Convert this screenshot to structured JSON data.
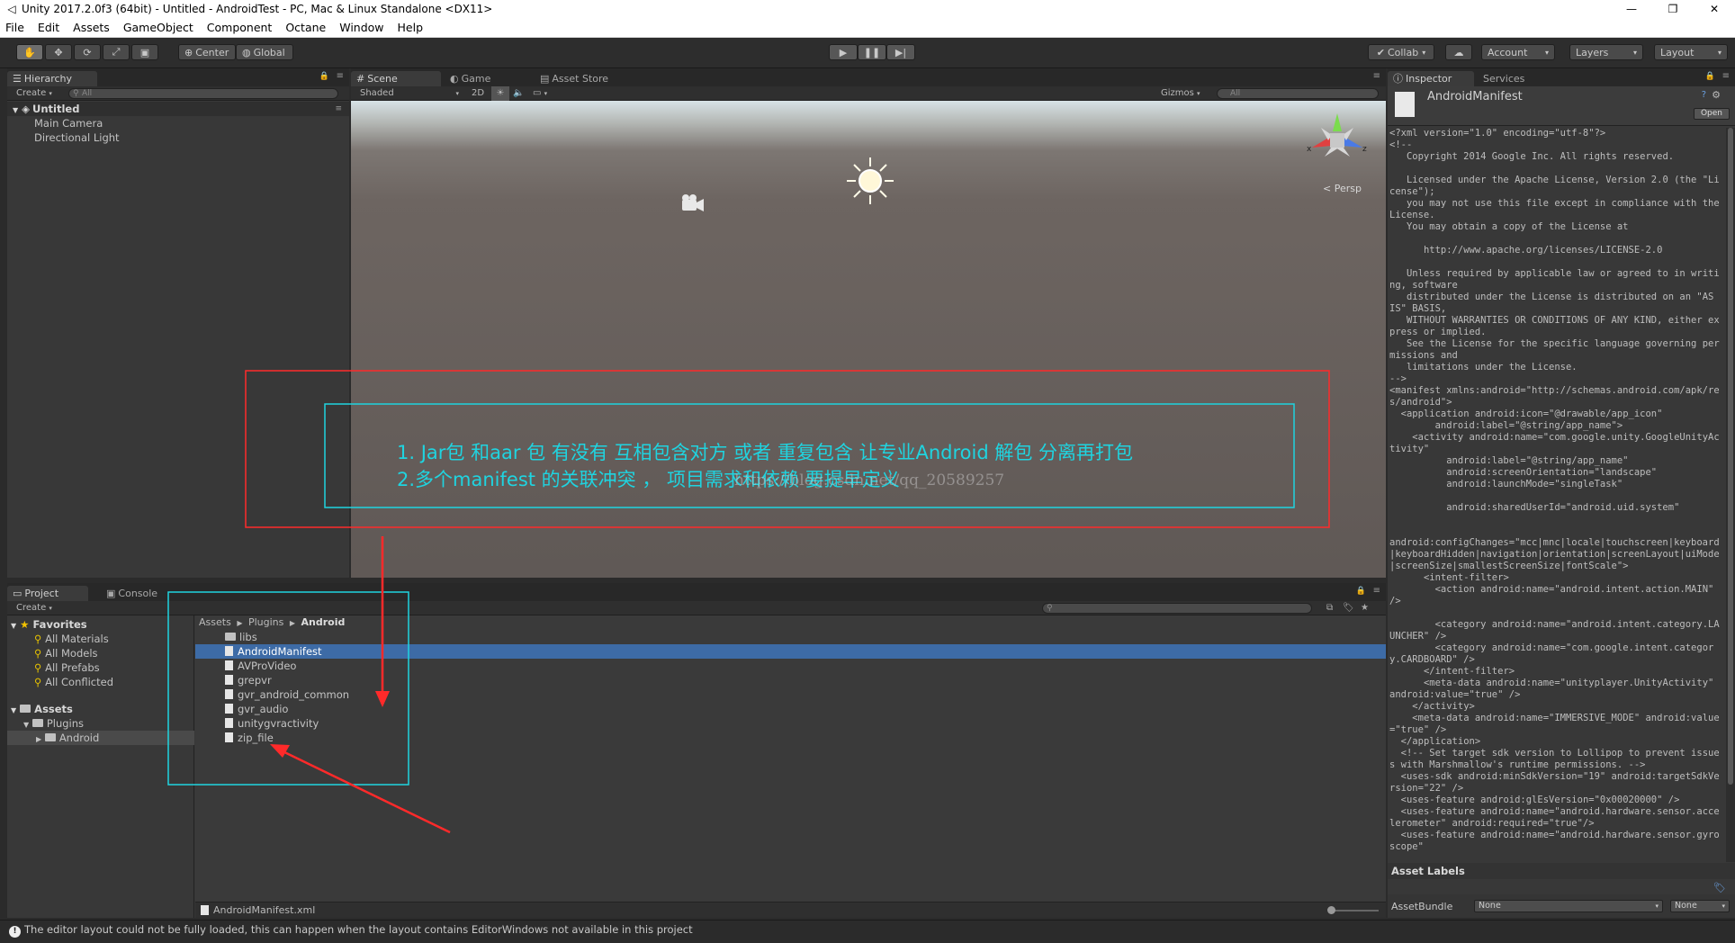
{
  "window": {
    "title": "Unity 2017.2.0f3 (64bit) - Untitled - AndroidTest - PC, Mac & Linux Standalone <DX11>",
    "minimize": "—",
    "maximize": "❐",
    "close": "✕"
  },
  "menu": [
    "File",
    "Edit",
    "Assets",
    "GameObject",
    "Component",
    "Octane",
    "Window",
    "Help"
  ],
  "toolbar": {
    "pivot": "Center",
    "space": "Global",
    "collab": "Collab",
    "account": "Account",
    "layers": "Layers",
    "layout": "Layout"
  },
  "hierarchy": {
    "tab": "Hierarchy",
    "create": "Create",
    "search_placeholder": "All",
    "scene": "Untitled",
    "items": [
      "Main Camera",
      "Directional Light"
    ]
  },
  "scene_view": {
    "tabs": [
      "Scene",
      "Game",
      "Asset Store"
    ],
    "shading": "Shaded",
    "mode_2d": "2D",
    "gizmos": "Gizmos",
    "search_placeholder": "All",
    "persp": "Persp",
    "axis_x": "x",
    "axis_z": "z"
  },
  "project": {
    "tabs": [
      "Project",
      "Console"
    ],
    "create": "Create",
    "favorites_label": "Favorites",
    "favorites": [
      "All Materials",
      "All Models",
      "All Prefabs",
      "All Conflicted"
    ],
    "assets_label": "Assets",
    "plugins_label": "Plugins",
    "android_label": "Android",
    "breadcrumb": [
      "Assets",
      "Plugins",
      "Android"
    ],
    "files": [
      {
        "name": "libs",
        "kind": "folder"
      },
      {
        "name": "AndroidManifest",
        "kind": "file",
        "selected": true
      },
      {
        "name": "AVProVideo",
        "kind": "file"
      },
      {
        "name": "grepvr",
        "kind": "file"
      },
      {
        "name": "gvr_android_common",
        "kind": "file"
      },
      {
        "name": "gvr_audio",
        "kind": "file"
      },
      {
        "name": "unitygvractivity",
        "kind": "file"
      },
      {
        "name": "zip_file",
        "kind": "file"
      }
    ],
    "footer_file": "AndroidManifest.xml"
  },
  "inspector": {
    "tabs": [
      "Inspector",
      "Services"
    ],
    "asset_name": "AndroidManifest",
    "open_button": "Open",
    "code": "<?xml version=\"1.0\" encoding=\"utf-8\"?>\n<!--\n   Copyright 2014 Google Inc. All rights reserved.\n\n   Licensed under the Apache License, Version 2.0 (the \"License\");\n   you may not use this file except in compliance with the License.\n   You may obtain a copy of the License at\n\n      http://www.apache.org/licenses/LICENSE-2.0\n\n   Unless required by applicable law or agreed to in writing, software\n   distributed under the License is distributed on an \"AS IS\" BASIS,\n   WITHOUT WARRANTIES OR CONDITIONS OF ANY KIND, either express or implied.\n   See the License for the specific language governing permissions and\n   limitations under the License.\n-->\n<manifest xmlns:android=\"http://schemas.android.com/apk/res/android\">\n  <application android:icon=\"@drawable/app_icon\"\n        android:label=\"@string/app_name\">\n    <activity android:name=\"com.google.unity.GoogleUnityActivity\"\n          android:label=\"@string/app_name\"\n          android:screenOrientation=\"landscape\"\n          android:launchMode=\"singleTask\"\n\n          android:sharedUserId=\"android.uid.system\"\n\n\nandroid:configChanges=\"mcc|mnc|locale|touchscreen|keyboard|keyboardHidden|navigation|orientation|screenLayout|uiMode|screenSize|smallestScreenSize|fontScale\">\n      <intent-filter>\n        <action android:name=\"android.intent.action.MAIN\" />\n\n        <category android:name=\"android.intent.category.LAUNCHER\" />\n        <category android:name=\"com.google.intent.category.CARDBOARD\" />\n      </intent-filter>\n      <meta-data android:name=\"unityplayer.UnityActivity\" android:value=\"true\" />\n    </activity>\n    <meta-data android:name=\"IMMERSIVE_MODE\" android:value=\"true\" />\n  </application>\n  <!-- Set target sdk version to Lollipop to prevent issues with Marshmallow's runtime permissions. -->\n  <uses-sdk android:minSdkVersion=\"19\" android:targetSdkVersion=\"22\" />\n  <uses-feature android:glEsVersion=\"0x00020000\" />\n  <uses-feature android:name=\"android.hardware.sensor.accelerometer\" android:required=\"true\"/>\n  <uses-feature android:name=\"android.hardware.sensor.gyroscope\"",
    "asset_labels": "Asset Labels",
    "asset_bundle_label": "AssetBundle",
    "asset_bundle_value": "None",
    "asset_variant_value": "None"
  },
  "status": {
    "message": "The editor layout could not be fully loaded, this can happen when the layout contains EditorWindows not available in this project"
  },
  "annotation": {
    "line1": "1. Jar包 和aar 包 有没有 互相包含对方   或者 重复包含    让专业Android 解包 分离再打包",
    "line2": "2.多个manifest 的关联冲突  ， 项目需求和依赖 要提早定义",
    "watermark": "https://blog.csdn.net/qq_20589257"
  },
  "colors": {
    "annotation_red": "#ff2a2a",
    "annotation_cyan": "#1fd4e0",
    "selection_blue": "#3d6ba6"
  }
}
